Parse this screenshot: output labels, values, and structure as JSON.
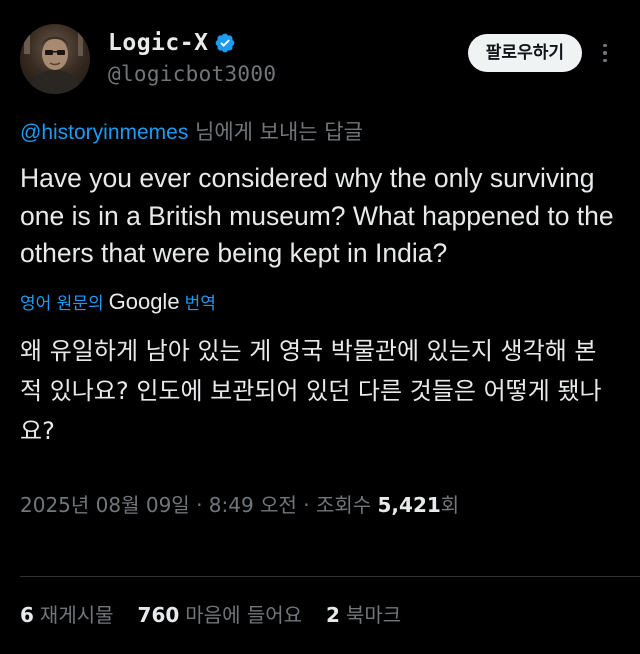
{
  "author": {
    "display_name": "Logic-X",
    "handle": "@logicbot3000",
    "verified_icon": "verified-badge-icon",
    "avatar_icon": "avatar-portrait-icon"
  },
  "actions": {
    "follow_label": "팔로우하기",
    "more_icon": "more-options-icon"
  },
  "reply": {
    "mention": "@historyinmemes",
    "suffix": " 님에게 보내는 답글"
  },
  "tweet": {
    "text": "Have you ever considered why the only surviving one is in a British museum? What happened to the others that were being kept in India?"
  },
  "translation": {
    "prefix": "영어 원문의",
    "provider": "Google",
    "suffix": "번역",
    "text": "왜 유일하게 남아 있는 게 영국 박물관에 있는지 생각해 본 적 있나요? 인도에 보관되어 있던 다른 것들은 어떻게 됐나요?"
  },
  "meta": {
    "date": "2025년 08월 09일",
    "separator": " · ",
    "time": "8:49 오전",
    "views_label": "조회수 ",
    "views_count": "5,421",
    "views_suffix": "회"
  },
  "stats": {
    "reposts_count": "6",
    "reposts_label": "재게시물",
    "likes_count": "760",
    "likes_label": "마음에 들어요",
    "bookmarks_count": "2",
    "bookmarks_label": "북마크"
  },
  "colors": {
    "background": "#000000",
    "text_primary": "#e7e9ea",
    "text_secondary": "#71767b",
    "accent": "#1d9bf0",
    "divider": "#2f3336",
    "follow_button_bg": "#eff3f4"
  }
}
